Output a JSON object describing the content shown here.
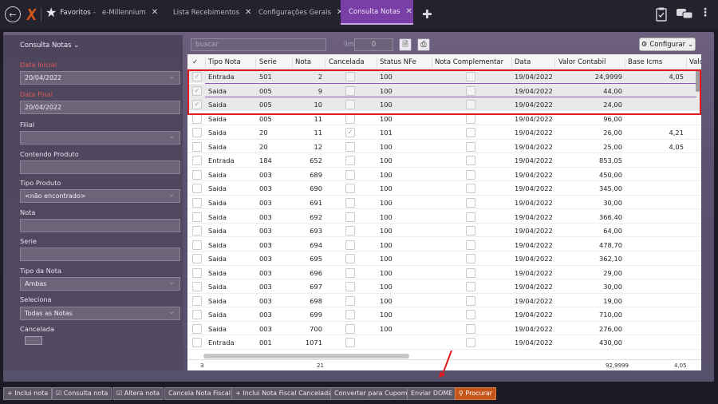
{
  "tabs": [
    {
      "label": "Favoritos",
      "suffix": "-"
    },
    {
      "label": "e-Millennium"
    },
    {
      "label": "Lista Recebimentos"
    },
    {
      "label": "Configurações Gerais"
    },
    {
      "label": "Consulta Notas"
    }
  ],
  "sidebar": {
    "title": "Consulta Notas ⌄",
    "data_inicial_label": "Data Inicial",
    "data_inicial": "20/04/2022",
    "data_final_label": "Data Final",
    "data_final": "20/04/2022",
    "filial_label": "Filial",
    "filial": "",
    "contendo_produto_label": "Contendo Produto",
    "contendo_produto": "",
    "tipo_produto_label": "Tipo Produto",
    "tipo_produto": "<não encontrado>",
    "nota_label": "Nota",
    "nota": "",
    "serie_label": "Serie",
    "serie": "",
    "tipo_nota_label": "Tipo da Nota",
    "tipo_nota": "Ambas",
    "seleciona_label": "Seleciona",
    "seleciona": "Todas as Notas",
    "cancelada_label": "Cancelada"
  },
  "toolbar": {
    "search_placeholder": "buscar",
    "limite_label": "limite:",
    "limite_value": "0",
    "configurar_label": "Configurar"
  },
  "grid": {
    "headers": [
      "Tipo Nota",
      "Serie",
      "Nota",
      "Cancelada",
      "Status NFe",
      "Nota Complementar",
      "Data",
      "Valor Contabil",
      "Base Icms",
      "Valo"
    ],
    "rows": [
      {
        "tipo": "Entrada",
        "serie": "501",
        "nota": "2",
        "cancelada": false,
        "status": "100",
        "data": "19/04/2022",
        "valor": "24,9999",
        "base": "4,05",
        "checked": true
      },
      {
        "tipo": "Saida",
        "serie": "005",
        "nota": "9",
        "cancelada": false,
        "status": "100",
        "data": "19/04/2022",
        "valor": "44,00",
        "base": "",
        "checked": true
      },
      {
        "tipo": "Saida",
        "serie": "005",
        "nota": "10",
        "cancelada": false,
        "status": "100",
        "data": "19/04/2022",
        "valor": "24,00",
        "base": "",
        "checked": true
      },
      {
        "tipo": "Saida",
        "serie": "005",
        "nota": "11",
        "cancelada": false,
        "status": "100",
        "data": "19/04/2022",
        "valor": "96,00",
        "base": "",
        "checked": false
      },
      {
        "tipo": "Saida",
        "serie": "20",
        "nota": "11",
        "cancelada": true,
        "status": "101",
        "data": "19/04/2022",
        "valor": "26,00",
        "base": "4,21",
        "checked": false
      },
      {
        "tipo": "Saida",
        "serie": "20",
        "nota": "12",
        "cancelada": false,
        "status": "100",
        "data": "19/04/2022",
        "valor": "25,00",
        "base": "4,05",
        "checked": false
      },
      {
        "tipo": "Entrada",
        "serie": "184",
        "nota": "652",
        "cancelada": false,
        "status": "100",
        "data": "19/04/2022",
        "valor": "853,05",
        "base": "",
        "checked": false
      },
      {
        "tipo": "Saida",
        "serie": "003",
        "nota": "689",
        "cancelada": false,
        "status": "100",
        "data": "19/04/2022",
        "valor": "450,00",
        "base": "",
        "checked": false
      },
      {
        "tipo": "Saida",
        "serie": "003",
        "nota": "690",
        "cancelada": false,
        "status": "100",
        "data": "19/04/2022",
        "valor": "345,00",
        "base": "",
        "checked": false
      },
      {
        "tipo": "Saida",
        "serie": "003",
        "nota": "691",
        "cancelada": false,
        "status": "100",
        "data": "19/04/2022",
        "valor": "30,00",
        "base": "",
        "checked": false
      },
      {
        "tipo": "Saida",
        "serie": "003",
        "nota": "692",
        "cancelada": false,
        "status": "100",
        "data": "19/04/2022",
        "valor": "366,40",
        "base": "",
        "checked": false
      },
      {
        "tipo": "Saida",
        "serie": "003",
        "nota": "693",
        "cancelada": false,
        "status": "100",
        "data": "19/04/2022",
        "valor": "64,00",
        "base": "",
        "checked": false
      },
      {
        "tipo": "Saida",
        "serie": "003",
        "nota": "694",
        "cancelada": false,
        "status": "100",
        "data": "19/04/2022",
        "valor": "478,70",
        "base": "",
        "checked": false
      },
      {
        "tipo": "Saida",
        "serie": "003",
        "nota": "695",
        "cancelada": false,
        "status": "100",
        "data": "19/04/2022",
        "valor": "362,10",
        "base": "",
        "checked": false
      },
      {
        "tipo": "Saida",
        "serie": "003",
        "nota": "696",
        "cancelada": false,
        "status": "100",
        "data": "19/04/2022",
        "valor": "29,00",
        "base": "",
        "checked": false
      },
      {
        "tipo": "Saida",
        "serie": "003",
        "nota": "697",
        "cancelada": false,
        "status": "100",
        "data": "19/04/2022",
        "valor": "30,00",
        "base": "",
        "checked": false
      },
      {
        "tipo": "Saida",
        "serie": "003",
        "nota": "698",
        "cancelada": false,
        "status": "100",
        "data": "19/04/2022",
        "valor": "19,00",
        "base": "",
        "checked": false
      },
      {
        "tipo": "Saida",
        "serie": "003",
        "nota": "699",
        "cancelada": false,
        "status": "100",
        "data": "19/04/2022",
        "valor": "710,00",
        "base": "",
        "checked": false
      },
      {
        "tipo": "Saida",
        "serie": "003",
        "nota": "700",
        "cancelada": false,
        "status": "100",
        "data": "19/04/2022",
        "valor": "276,00",
        "base": "",
        "checked": false
      },
      {
        "tipo": "Entrada",
        "serie": "001",
        "nota": "1071",
        "cancelada": false,
        "status": "",
        "data": "19/04/2022",
        "valor": "430,00",
        "base": "",
        "checked": false
      }
    ],
    "footer": {
      "count": "3",
      "nota_total": "21",
      "valor_total": "92,9999",
      "base_total": "4,05"
    }
  },
  "bottom_buttons": [
    {
      "label": "+ Inclui nota"
    },
    {
      "label": "☑ Consulta nota"
    },
    {
      "label": "☑ Altera nota"
    },
    {
      "label": "Cancela Nota Fiscal"
    },
    {
      "label": "+ Inclui Nota Fiscal Cancelada"
    },
    {
      "label": "Converter para Cupom"
    },
    {
      "label": "Enviar DOME"
    },
    {
      "label": "Procurar"
    }
  ],
  "colors": {
    "accent": "#7a3fa6",
    "highlight": "#e0191f",
    "action": "#c4551b"
  }
}
